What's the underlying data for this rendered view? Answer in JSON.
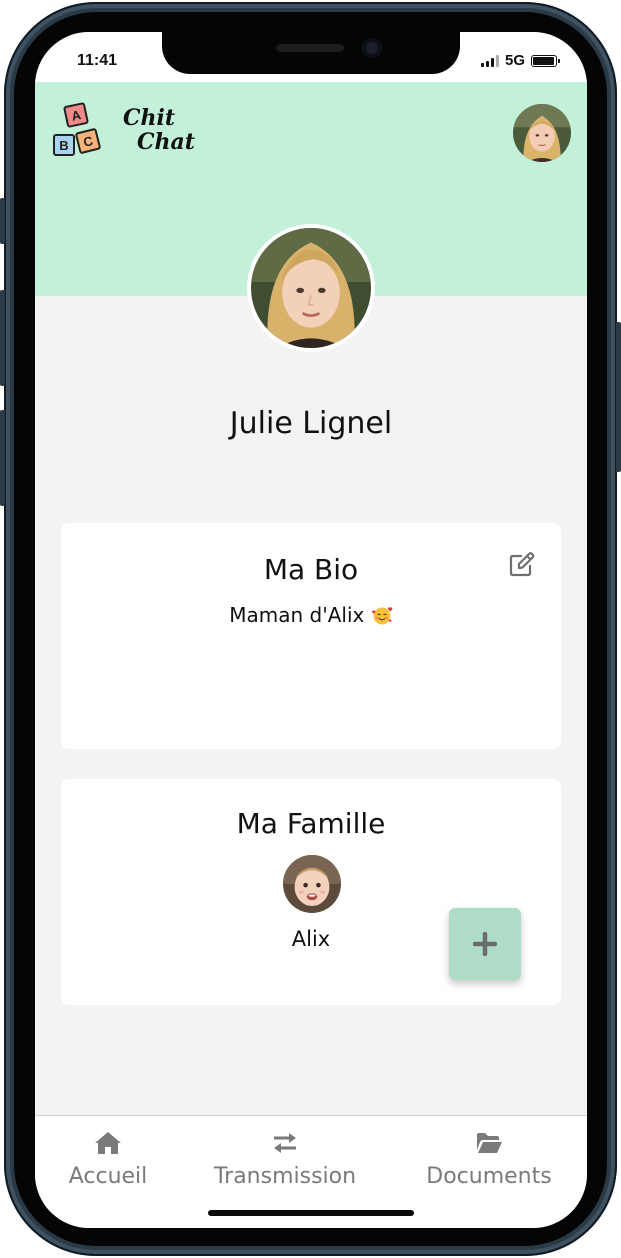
{
  "status_bar": {
    "time": "11:41",
    "network": "5G",
    "battery_level": 0.95
  },
  "header": {
    "logo": {
      "blocks": [
        "A",
        "B",
        "C"
      ],
      "text_line1": "Chit",
      "text_line2": "Chat"
    },
    "background_color": "#c2f0d9",
    "avatar_icon": "user-avatar"
  },
  "profile": {
    "name": "Julie Lignel"
  },
  "bio_card": {
    "title": "Ma Bio",
    "text": "Maman d'Alix",
    "emoji_icon": "smiling-face-with-hearts-icon",
    "edit_icon": "edit-pencil-icon"
  },
  "family_card": {
    "title": "Ma Famille",
    "members": [
      {
        "name": "Alix"
      }
    ],
    "add_icon": "plus-icon",
    "add_button_color": "#afdcc6"
  },
  "bottom_nav": {
    "items": [
      {
        "label": "Accueil",
        "icon": "home-icon"
      },
      {
        "label": "Transmission",
        "icon": "transfer-arrows-icon"
      },
      {
        "label": "Documents",
        "icon": "folder-open-icon"
      }
    ]
  }
}
